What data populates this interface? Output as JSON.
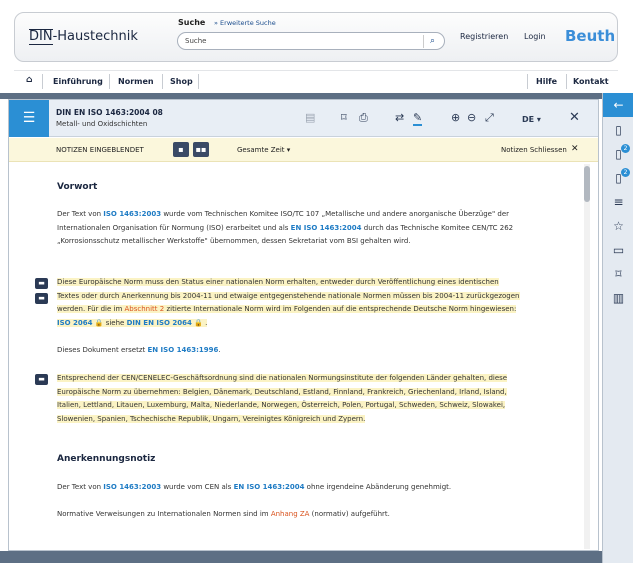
{
  "header": {
    "logo_prefix": "DIN",
    "logo_suffix": "-Haustechnik",
    "search_label": "Suche",
    "advanced_search": "» Erweiterte Suche",
    "search_placeholder": "Suche",
    "register": "Registrieren",
    "login": "Login",
    "brand": "Beuth"
  },
  "nav": {
    "home_icon": "home-icon",
    "items": [
      "Einführung",
      "Normen",
      "Shop"
    ],
    "right_items": [
      "Hilfe",
      "Kontakt"
    ]
  },
  "document": {
    "title": "DIN EN ISO 1463:2004 08",
    "subtitle": "Metall- und Oxidschichten",
    "language": "DE ▾"
  },
  "notesbar": {
    "notes_shown": "NOTIZEN EINGEBLENDET",
    "time_filter": "Gesamte Zeit ▾",
    "close_notes": "Notizen Schliessen"
  },
  "content": {
    "h_vorwort": "Vorwort",
    "p1": {
      "a": "Der Text von ",
      "link1": "ISO 1463:2003",
      "b": " wurde vom Technischen Komitee ISO/TC 107 „Metallische und andere anorganische Überzüge\" der Internationalen Organisation für Normung (ISO) erarbeitet und als ",
      "link2": "EN ISO 1463:2004",
      "c": " durch das Technische Komitee CEN/TC 262 „Korrosionsschutz metallischer Werkstoffe\" übernommen, dessen Sekretariat vom BSI gehalten wird."
    },
    "p2": {
      "a": "Diese Europäische Norm muss den Status einer nationalen Norm erhalten, entweder durch Veröffentlichung eines identischen Textes oder durch Anerkennung bis 2004-11 und etwaige entgegenstehende nationale Normen müssen bis 2004-11 zurückgezogen werden. Für die im ",
      "link1": "Abschnitt 2",
      "b": " zitierte Internationale Norm wird im Folgenden auf die entsprechende Deutsche Norm hingewiesen: ",
      "link2": "ISO 2064",
      "c": " siehe ",
      "link3": "DIN EN ISO 2064",
      "d": " ."
    },
    "p3": {
      "a": "Dieses Dokument ersetzt ",
      "link1": "EN ISO 1463:1996",
      "b": "."
    },
    "p4": "Entsprechend der CEN/CENELEC-Geschäftsordnung sind die nationalen Normungsinstitute der folgenden Länder gehalten, diese Europäische Norm zu übernehmen: Belgien, Dänemark, Deutschland, Estland, Finnland, Frankreich, Griechenland, Irland, Island, Italien, Lettland, Litauen, Luxemburg, Malta, Niederlande, Norwegen, Österreich, Polen, Portugal, Schweden, Schweiz, Slowakei, Slowenien, Spanien, Tschechische Republik, Ungarn, Vereinigtes Königreich und Zypern.",
    "h_anerk": "Anerkennungsnotiz",
    "p5": {
      "a": "Der Text von ",
      "link1": "ISO 1463:2003",
      "b": " wurde vom CEN als ",
      "link2": "EN ISO 1463:2004",
      "c": " ohne irgendeine Abänderung genehmigt."
    },
    "p6": {
      "a": "Normative Verweisungen zu Internationalen Normen sind im ",
      "link1": "Anhang ZA",
      "b": " (normativ) aufgeführt."
    }
  },
  "sidebar": {
    "badge1": "2",
    "badge2": "2"
  }
}
